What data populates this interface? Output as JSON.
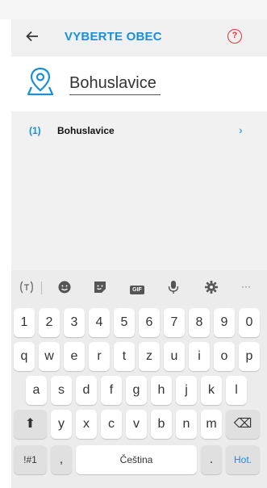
{
  "header": {
    "title": "VYBERTE OBEC",
    "back_icon": "arrow-left-icon",
    "help_icon": "question-circle-icon",
    "accent": "#1a8fd8",
    "help_color": "#e0383a"
  },
  "search": {
    "value": "Bohuslavice",
    "icon": "map-pin-icon"
  },
  "results": [
    {
      "index": "(1)",
      "name": "Bohuslavice",
      "chevron": "›"
    }
  ],
  "keyboard": {
    "toolbar": [
      "text-translate-icon",
      "emoji-icon",
      "sticker-icon",
      "gif-icon",
      "mic-icon",
      "gear-icon",
      "more-icon"
    ],
    "toolbar_labels": {
      "gif": "GIF",
      "more": "···"
    },
    "row1": [
      "1",
      "2",
      "3",
      "4",
      "5",
      "6",
      "7",
      "8",
      "9",
      "0"
    ],
    "row2": [
      "q",
      "w",
      "e",
      "r",
      "t",
      "z",
      "u",
      "i",
      "o",
      "p"
    ],
    "row3": [
      "a",
      "s",
      "d",
      "f",
      "g",
      "h",
      "j",
      "k",
      "l"
    ],
    "row4": [
      "y",
      "x",
      "c",
      "v",
      "b",
      "n",
      "m"
    ],
    "shift": "⬆",
    "backspace": "⌫",
    "symbols": "!#1",
    "comma": ",",
    "space": "Čeština",
    "period": ".",
    "enter": "Hot."
  }
}
